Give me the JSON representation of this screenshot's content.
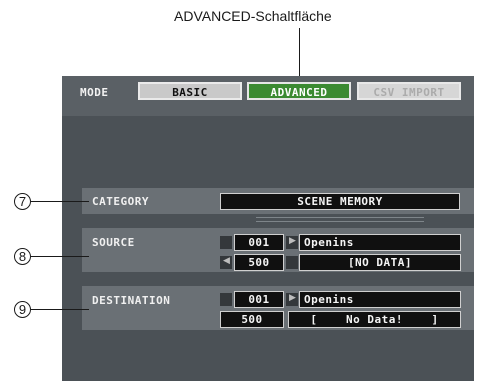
{
  "callout": {
    "advanced_label": "ADVANCED-Schaltfläche"
  },
  "mode_bar": {
    "mode_label": "MODE",
    "buttons": [
      {
        "label": "BASIC",
        "state": "normal"
      },
      {
        "label": "ADVANCED",
        "state": "active"
      },
      {
        "label": "CSV IMPORT",
        "state": "disabled"
      }
    ]
  },
  "fields": {
    "category": {
      "number": "7",
      "label": "CATEGORY",
      "value": "SCENE MEMORY"
    },
    "source": {
      "number": "8",
      "label": "SOURCE",
      "row1": {
        "num": "001",
        "name": "Openins"
      },
      "row2": {
        "num": "500",
        "name": "[NO DATA]"
      }
    },
    "destination": {
      "number": "9",
      "label": "DESTINATION",
      "row1": {
        "num": "001",
        "name": "Openins"
      },
      "row2": {
        "num": "500",
        "name": "[    No Data!    ]"
      }
    }
  },
  "colors": {
    "panel": "#4b5156",
    "active_button": "#3b8a31",
    "row_background": "#6a7075"
  }
}
